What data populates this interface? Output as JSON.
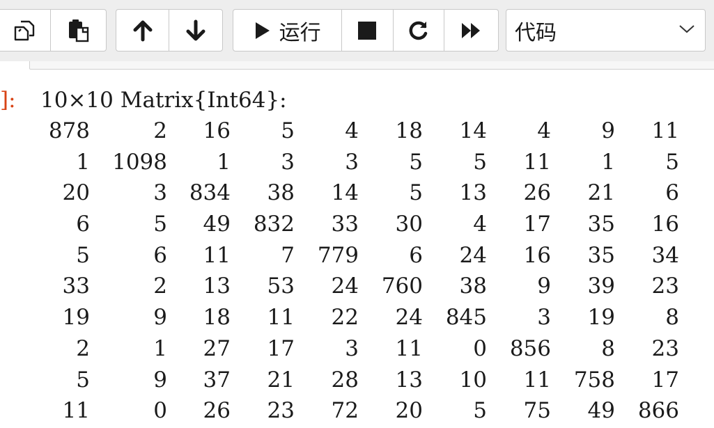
{
  "toolbar": {
    "copy_icon": "copy-icon",
    "paste_icon": "paste-icon",
    "move_up_icon": "arrow-up-icon",
    "move_down_icon": "arrow-down-icon",
    "run_label": "运行",
    "stop_icon": "stop-icon",
    "restart_icon": "restart-icon",
    "run_all_icon": "fast-forward-icon",
    "cell_type": "代码"
  },
  "output": {
    "prompt": "]:",
    "header": "10×10 Matrix{Int64}:",
    "matrix": [
      [
        "878",
        "2",
        "16",
        "5",
        "4",
        "18",
        "14",
        "4",
        "9",
        "11"
      ],
      [
        "1",
        "1098",
        "1",
        "3",
        "3",
        "5",
        "5",
        "11",
        "1",
        "5"
      ],
      [
        "20",
        "3",
        "834",
        "38",
        "14",
        "5",
        "13",
        "26",
        "21",
        "6"
      ],
      [
        "6",
        "5",
        "49",
        "832",
        "33",
        "30",
        "4",
        "17",
        "35",
        "16"
      ],
      [
        "5",
        "6",
        "11",
        "7",
        "779",
        "6",
        "24",
        "16",
        "35",
        "34"
      ],
      [
        "33",
        "2",
        "13",
        "53",
        "24",
        "760",
        "38",
        "9",
        "39",
        "23"
      ],
      [
        "19",
        "9",
        "18",
        "11",
        "22",
        "24",
        "845",
        "3",
        "19",
        "8"
      ],
      [
        "2",
        "1",
        "27",
        "17",
        "3",
        "11",
        "0",
        "856",
        "8",
        "23"
      ],
      [
        "5",
        "9",
        "37",
        "21",
        "28",
        "13",
        "10",
        "11",
        "758",
        "17"
      ],
      [
        "11",
        "0",
        "26",
        "23",
        "72",
        "20",
        "5",
        "75",
        "49",
        "866"
      ]
    ]
  },
  "colors": {
    "prompt": "#d84315",
    "toolbar_bg": "#eeeeee",
    "border": "#c8c8c8"
  }
}
